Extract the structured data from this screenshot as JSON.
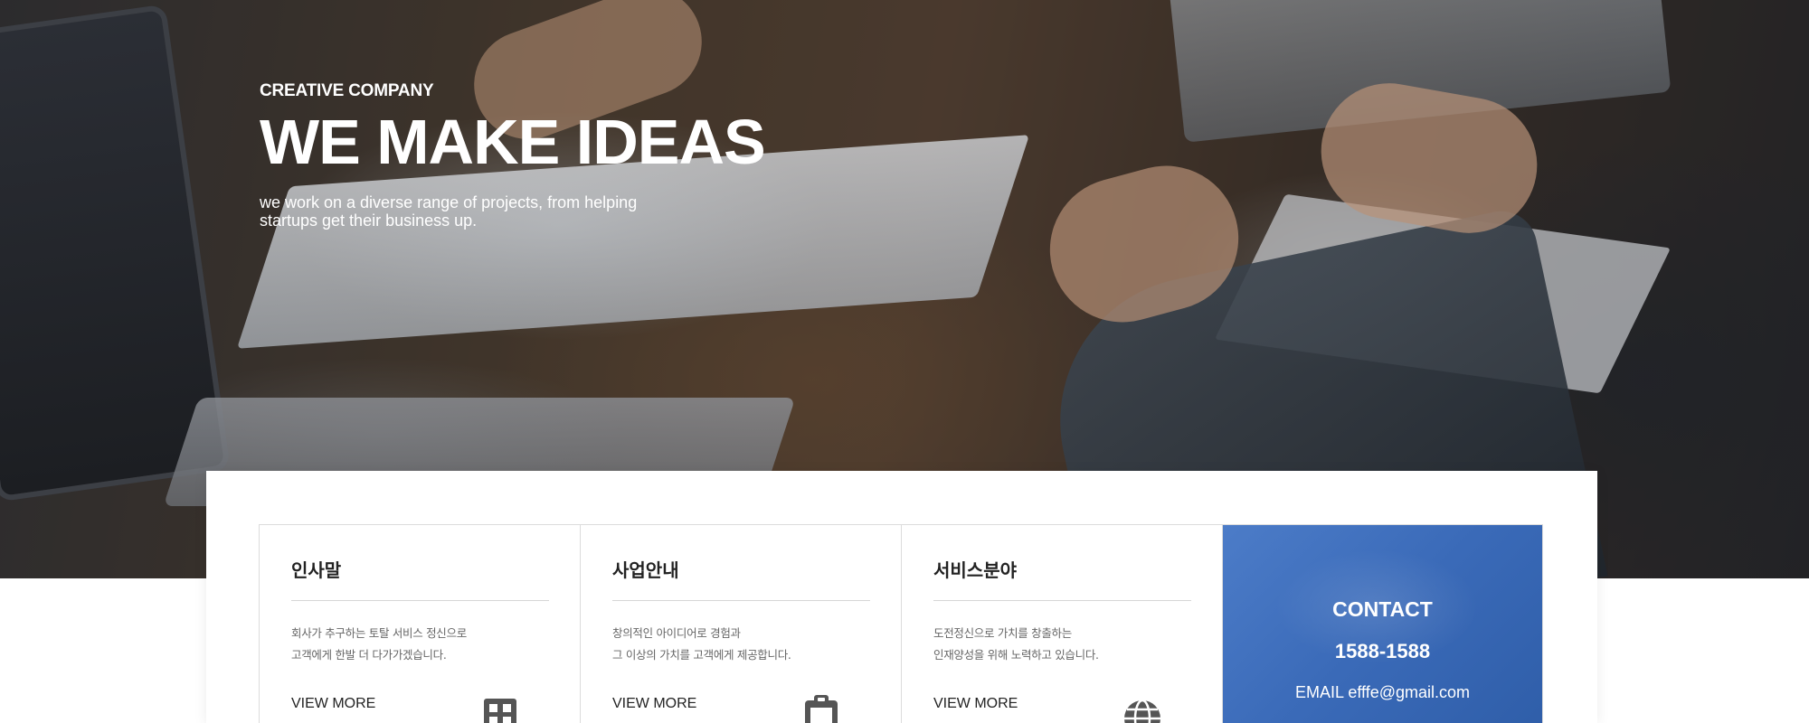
{
  "hero": {
    "eyebrow": "CREATIVE COMPANY",
    "headline": "WE MAKE IDEAS",
    "subline_1": "we work on a diverse range of projects, from helping",
    "subline_2": "startups get their business up."
  },
  "cards": [
    {
      "title": "인사말",
      "desc_1": "회사가 추구하는 토탈 서비스 정신으로",
      "desc_2": "고객에게 한발 더 다가가겠습니다.",
      "more": "VIEW MORE",
      "icon": "building-icon"
    },
    {
      "title": "사업안내",
      "desc_1": "창의적인 아이디어로 경험과",
      "desc_2": "그 이상의 가치를 고객에게 제공합니다.",
      "more": "VIEW MORE",
      "icon": "clipboard-icon"
    },
    {
      "title": "서비스분야",
      "desc_1": "도전정신으로 가치를 창출하는",
      "desc_2": "인재양성을 위해 노력하고 있습니다.",
      "more": "VIEW MORE",
      "icon": "globe-icon"
    }
  ],
  "contact": {
    "title": "CONTACT",
    "phone": "1588-1588",
    "email": "EMAIL efffe@gmail.com"
  },
  "colors": {
    "contact_bg": "#3a6ab8",
    "icon": "#555555"
  }
}
